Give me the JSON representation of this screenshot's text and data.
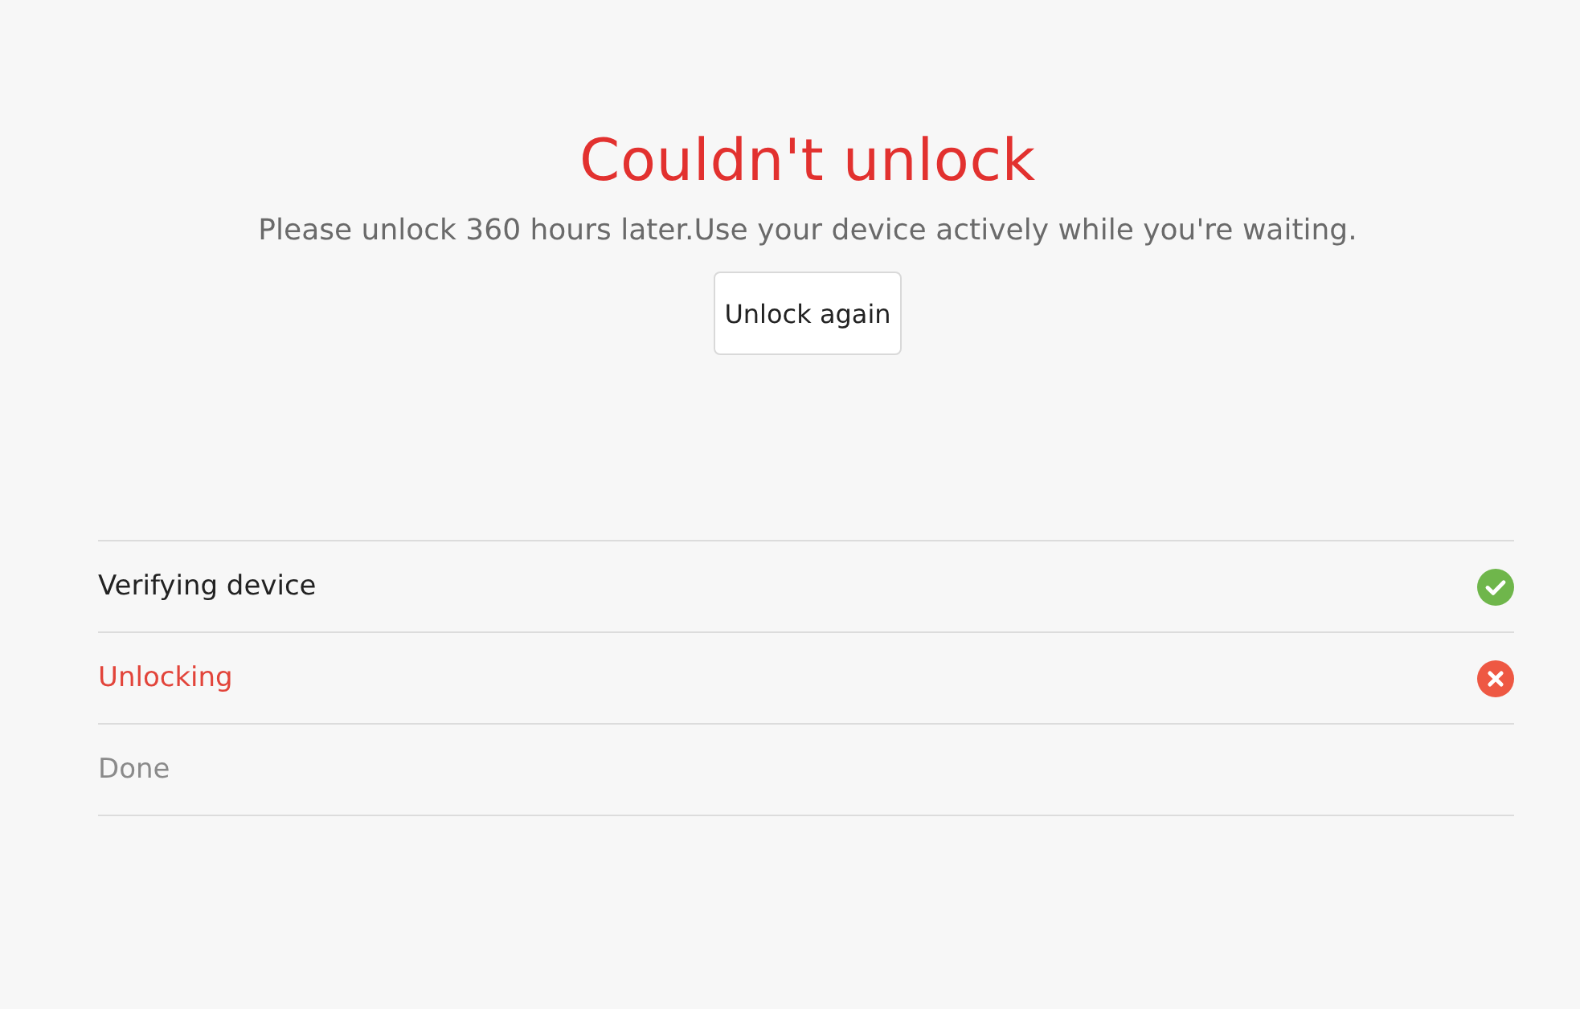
{
  "header": {
    "title": "Couldn't unlock",
    "message": "Please unlock 360 hours later.Use your device actively while you're waiting.",
    "button": "Unlock again"
  },
  "steps": [
    {
      "label": "Verifying device",
      "kind": "done"
    },
    {
      "label": "Unlocking",
      "kind": "failed"
    },
    {
      "label": "Done",
      "kind": "pending"
    }
  ]
}
